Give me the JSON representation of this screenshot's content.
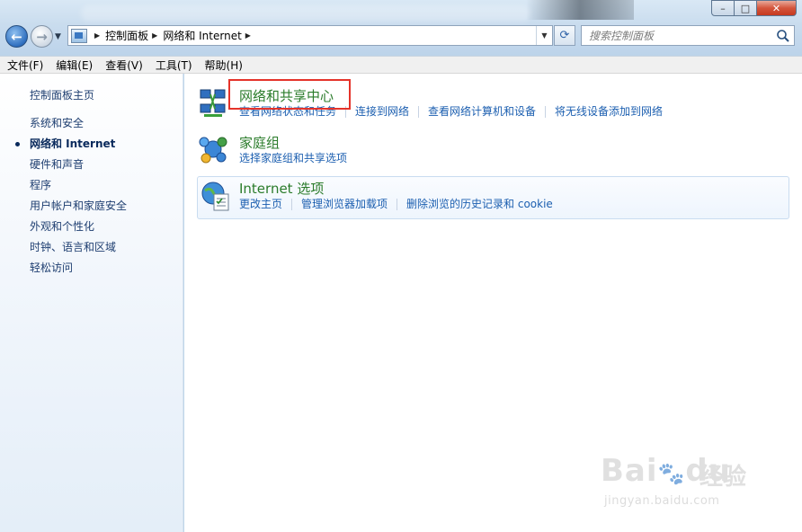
{
  "window": {
    "buttons": {
      "minimize": "–",
      "maximize": "□",
      "close": "✕"
    }
  },
  "nav": {
    "back_icon": "arrow-left-icon",
    "forward_icon": "arrow-right-icon"
  },
  "address": {
    "segments": [
      "控制面板",
      "网络和 Internet"
    ]
  },
  "search": {
    "placeholder": "搜索控制面板"
  },
  "menu": {
    "items": [
      "文件(F)",
      "编辑(E)",
      "查看(V)",
      "工具(T)",
      "帮助(H)"
    ]
  },
  "sidebar": {
    "home": "控制面板主页",
    "items": [
      {
        "label": "系统和安全"
      },
      {
        "label": "网络和 Internet",
        "active": true
      },
      {
        "label": "硬件和声音"
      },
      {
        "label": "程序"
      },
      {
        "label": "用户帐户和家庭安全"
      },
      {
        "label": "外观和个性化"
      },
      {
        "label": "时钟、语言和区域"
      },
      {
        "label": "轻松访问"
      }
    ]
  },
  "categories": {
    "network": {
      "title": "网络和共享中心",
      "links": [
        "查看网络状态和任务",
        "连接到网络",
        "查看网络计算机和设备",
        "将无线设备添加到网络"
      ]
    },
    "homegroup": {
      "title": "家庭组",
      "links": [
        "选择家庭组和共享选项"
      ]
    },
    "internet": {
      "title": "Internet 选项",
      "links": [
        "更改主页",
        "管理浏览器加载项",
        "删除浏览的历史记录和 cookie"
      ]
    }
  },
  "watermark": {
    "brand": "Bai",
    "brand2": "du",
    "cn": "经验",
    "url": "jingyan.baidu.com"
  },
  "colors": {
    "link": "#1c5fb0",
    "category_title": "#2b7c2b",
    "highlight": "#e5332a"
  }
}
